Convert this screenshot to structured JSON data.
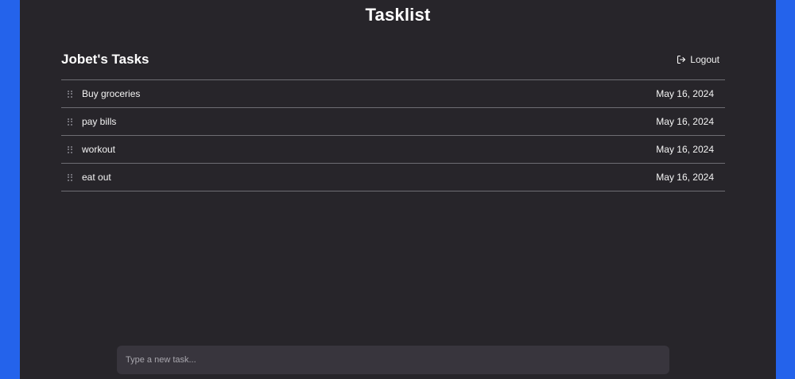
{
  "app": {
    "title": "Tasklist"
  },
  "header": {
    "list_title": "Jobet's Tasks",
    "logout_label": "Logout",
    "logout_icon": "logout-icon"
  },
  "tasks": [
    {
      "text": "Buy groceries",
      "date": "May 16, 2024"
    },
    {
      "text": "pay bills",
      "date": "May 16, 2024"
    },
    {
      "text": "workout",
      "date": "May 16, 2024"
    },
    {
      "text": "eat out",
      "date": "May 16, 2024"
    }
  ],
  "new_task": {
    "placeholder": "Type a new task...",
    "value": ""
  },
  "colors": {
    "page_background": "#2463eb",
    "panel_background": "#27252a",
    "input_background": "#38353d",
    "divider": "#6e6d73"
  }
}
